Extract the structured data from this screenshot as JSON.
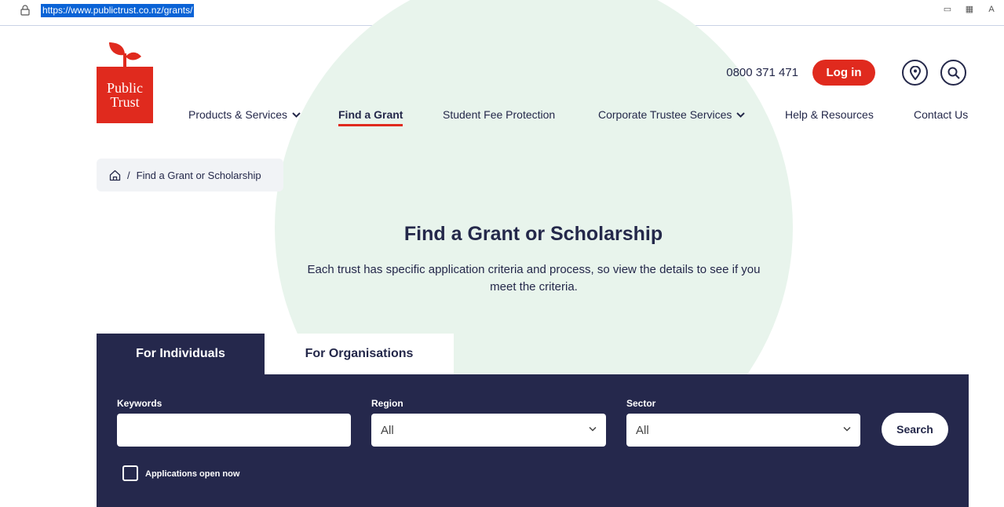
{
  "browser": {
    "url": "https://www.publictrust.co.nz/grants/"
  },
  "logo": {
    "line1": "Public",
    "line2": "Trust"
  },
  "header": {
    "phone": "0800 371 471",
    "login_label": "Log in"
  },
  "nav": {
    "items": [
      {
        "label": "Products & Services",
        "has_dropdown": true
      },
      {
        "label": "Find a Grant",
        "active": true
      },
      {
        "label": "Student Fee Protection"
      },
      {
        "label": "Corporate Trustee Services",
        "has_dropdown": true
      },
      {
        "label": "Help & Resources"
      },
      {
        "label": "Contact Us"
      }
    ]
  },
  "breadcrumb": {
    "separator": "/",
    "current": "Find a Grant or Scholarship"
  },
  "hero": {
    "title": "Find a Grant or Scholarship",
    "subtitle": "Each trust has specific application criteria and process, so view the details to see if you meet the criteria."
  },
  "tabs": [
    {
      "label": "For Individuals",
      "active": true
    },
    {
      "label": "For Organisations",
      "active": false
    }
  ],
  "search_form": {
    "keywords_label": "Keywords",
    "keywords_value": "",
    "region_label": "Region",
    "region_value": "All",
    "sector_label": "Sector",
    "sector_value": "All",
    "search_label": "Search",
    "checkbox_label": "Applications open now",
    "checkbox_checked": false
  },
  "colors": {
    "brand_red": "#e02a1e",
    "navy": "#25284c",
    "mint": "#e8f4ec"
  }
}
